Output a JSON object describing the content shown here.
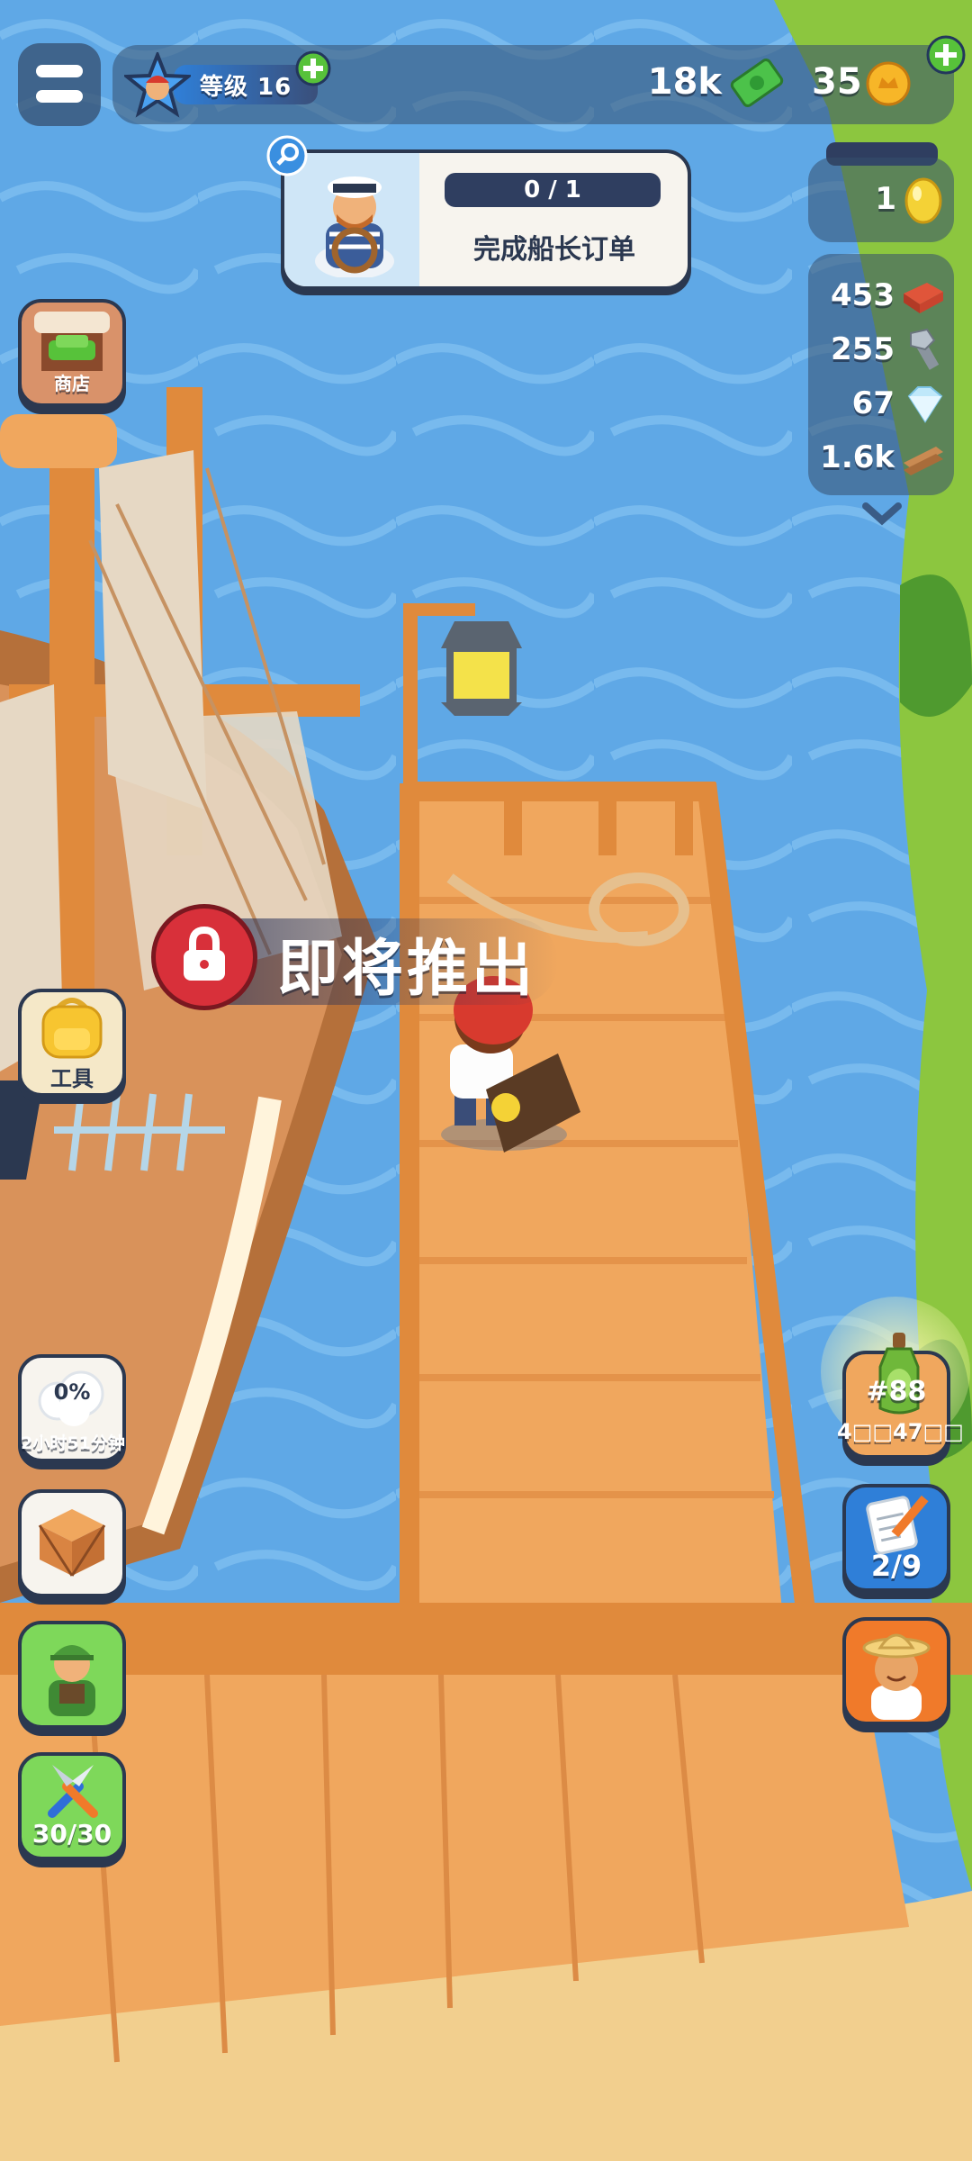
{
  "top_bar": {
    "level_label": "等级 16",
    "cash": "18k",
    "coins": "35"
  },
  "quest": {
    "progress": "0 / 1",
    "title": "完成船长订单"
  },
  "resources": {
    "eggs": "1",
    "bricks": "453",
    "bolts": "255",
    "gems": "67",
    "planks": "1.6k"
  },
  "left_buttons": {
    "shop_label": "商店",
    "tools_label": "工具",
    "cotton_percent": "0%",
    "cotton_timer": "2小时51分钟",
    "energy": "30/30"
  },
  "banner": {
    "text": "即将推出"
  },
  "right_buttons": {
    "order_number": "#88",
    "order_timer": "4□□47□□",
    "tasks": "2/9"
  },
  "colors": {
    "water": "#5fa8e6",
    "wood": "#f0a75e",
    "panel": "#344e6e",
    "green_plus": "#57c23a",
    "lock_red": "#d8303a"
  }
}
